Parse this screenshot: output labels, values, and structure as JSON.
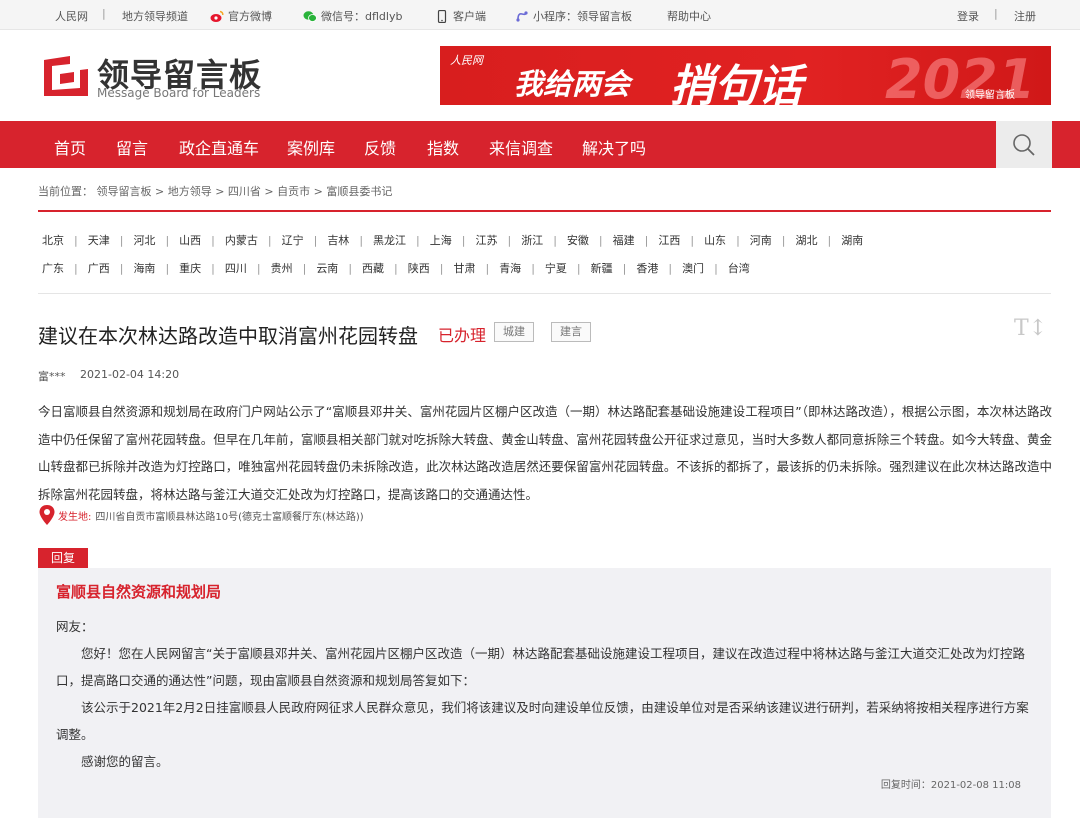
{
  "topbar": {
    "people": "人民网",
    "channel": "地方领导频道",
    "weibo": "官方微博",
    "wechat": "微信号：dfldlyb",
    "client": "客户端",
    "miniprogram": "小程序：领导留言板",
    "help": "帮助中心",
    "login": "登录",
    "register": "注册"
  },
  "header": {
    "logo_cn": "领导留言板",
    "logo_en": "Message Board for Leaders",
    "banner": {
      "brand": "人民网",
      "main": "我给两会",
      "big": "捎句话",
      "year": "2021",
      "small": "领导留言板"
    }
  },
  "nav": {
    "items": [
      "首页",
      "留言",
      "政企直通车",
      "案例库",
      "反馈",
      "指数",
      "来信调查",
      "解决了吗"
    ]
  },
  "breadcrumb": {
    "text": "当前位置： 领导留言板 > 地方领导 > 四川省 > 自贡市 > 富顺县委书记"
  },
  "provinces": {
    "row1": [
      "北京",
      "天津",
      "河北",
      "山西",
      "内蒙古",
      "辽宁",
      "吉林",
      "黑龙江",
      "上海",
      "江苏",
      "浙江",
      "安徽",
      "福建",
      "江西",
      "山东",
      "河南",
      "湖北",
      "湖南"
    ],
    "row2": [
      "广东",
      "广西",
      "海南",
      "重庆",
      "四川",
      "贵州",
      "云南",
      "西藏",
      "陕西",
      "甘肃",
      "青海",
      "宁夏",
      "新疆",
      "香港",
      "澳门",
      "台湾"
    ]
  },
  "message": {
    "title": "建议在本次林达路改造中取消富州花园转盘",
    "status": "已办理",
    "tags": [
      "城建",
      "建言"
    ],
    "font_toggle": "T↕",
    "author": "富***",
    "date": "2021-02-04 14:20",
    "body": "今日富顺县自然资源和规划局在政府门户网站公示了“富顺县邓井关、富州花园片区棚户区改造（一期）林达路配套基础设施建设工程项目”（即林达路改造），根据公示图，本次林达路改造中仍任保留了富州花园转盘。但早在几年前，富顺县相关部门就对吃拆除大转盘、黄金山转盘、富州花园转盘公开征求过意见，当时大多数人都同意拆除三个转盘。如今大转盘、黄金山转盘都已拆除并改造为灯控路口，唯独富州花园转盘仍未拆除改造，此次林达路改造居然还要保留富州花园转盘。不该拆的都拆了，最该拆的仍未拆除。强烈建议在此次林达路改造中拆除富州花园转盘，将林达路与釜江大道交汇处改为灯控路口，提高该路口的交通通达性。",
    "location_label": "发生地:",
    "location": "四川省自贡市富顺县林达路10号(德克士富顺餐厅东(林达路))"
  },
  "reply": {
    "badge": "回复",
    "org": "富顺县自然资源和规划局",
    "greeting": "网友：",
    "p1": "您好！您在人民网留言“关于富顺县邓井关、富州花园片区棚户区改造（一期）林达路配套基础设施建设工程项目，建议在改造过程中将林达路与釜江大道交汇处改为灯控路口，提高路口交通的通达性”问题，现由富顺县自然资源和规划局答复如下：",
    "p2": "该公示于2021年2月2日挂富顺县人民政府网征求人民群众意见，我们将该建议及时向建设单位反馈，由建设单位对是否采纳该建议进行研判，若采纳将按相关程序进行方案调整。",
    "p3": "感谢您的留言。",
    "time_label": "回复时间：",
    "time": "2021-02-08 11:08"
  },
  "colors": {
    "brand_red": "#d7232d",
    "reply_bg": "#f1f1f4",
    "topbar_bg": "#f5f5f5"
  }
}
